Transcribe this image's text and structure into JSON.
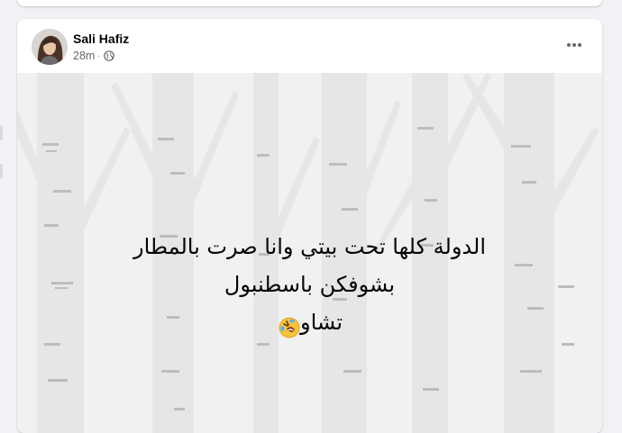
{
  "post": {
    "author": "Sali Hafiz",
    "time": "28m",
    "separator": "·",
    "privacy_icon": "globe-icon",
    "more_icon": "more-horizontal-icon",
    "background": "birch-forest-gray",
    "text_lines": [
      "الدولة كلها تحت بيتي وانا صرت بالمطار",
      "بشوفكن باسطنبول",
      "تشاو"
    ],
    "emoji": "rolling-on-floor-laughing-icon"
  },
  "colors": {
    "page_bg": "#f0f2f5",
    "card_bg": "#ffffff",
    "name_text": "#050505",
    "meta_text": "#65676b",
    "media_bg": "#f1f1f1"
  }
}
